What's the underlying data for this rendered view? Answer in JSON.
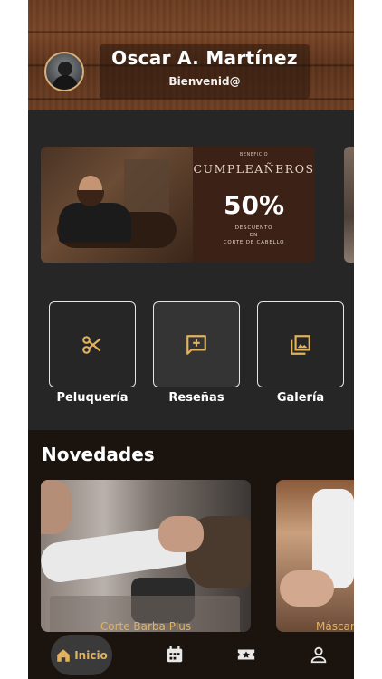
{
  "user": {
    "name": "Oscar A. Martínez",
    "greeting": "Bienvenid@"
  },
  "promo": {
    "kicker": "BENEFICIO",
    "title": "CUMPLEAÑEROS",
    "discount": "50%",
    "line1": "DESCUENTO",
    "line2": "EN",
    "line3": "CORTE DE CABELLO"
  },
  "services": [
    {
      "label": "Peluquería",
      "icon": "scissors-icon"
    },
    {
      "label": "Reseñas",
      "icon": "review-icon"
    },
    {
      "label": "Galería",
      "icon": "gallery-icon"
    }
  ],
  "news": {
    "title": "Novedades",
    "items": [
      {
        "label": "Corte Barba Plus"
      },
      {
        "label": "Máscara"
      }
    ]
  },
  "nav": {
    "home_label": "Inicio",
    "items": [
      "home-icon",
      "calendar-icon",
      "ticket-star-icon",
      "profile-icon"
    ]
  },
  "colors": {
    "accent": "#e2b25d",
    "background": "#262626",
    "dark": "#1b140e"
  }
}
